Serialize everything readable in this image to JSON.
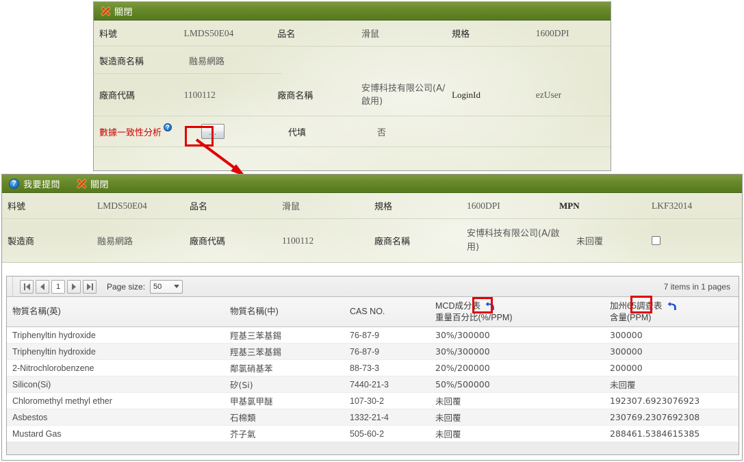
{
  "panel1": {
    "titlebar": {
      "close_label": "關閉",
      "close_icon": "close-x-icon"
    },
    "rows": [
      {
        "label1": "料號",
        "value1": "LMDS50E04",
        "label2": "品名",
        "value2": "滑鼠",
        "label3": "規格",
        "value3": "1600DPI"
      },
      {
        "label1": "製造商名稱",
        "value1": "融易網路"
      },
      {
        "label1": "廠商代碼",
        "value1": "1100112",
        "label2": "廠商名稱",
        "value2": "安博科技有限公司(A/啟用)",
        "label3": "LoginId",
        "value3": "ezUser"
      },
      {
        "label1": "數據一致性分析",
        "help_icon": "help-circle-icon",
        "button_label": "...",
        "label2": "代填",
        "value2": "否"
      }
    ]
  },
  "panel2": {
    "titlebar": {
      "ask_label": "我要提問",
      "ask_icon": "help-circle-icon",
      "close_label": "關閉",
      "close_icon": "close-x-icon"
    },
    "info": {
      "row1": {
        "label1": "料號",
        "value1": "LMDS50E04",
        "label2": "品名",
        "value2": "滑鼠",
        "label3": "規格",
        "value3": "1600DPI",
        "label4": "MPN",
        "value4": "LKF32014"
      },
      "row2": {
        "label1": "製造商",
        "value1": "融易網路",
        "label2": "廠商代碼",
        "value2": "1100112",
        "label3": "廠商名稱",
        "value3": "安博科技有限公司(A/啟用)",
        "value4": "未回覆",
        "checkbox": "unchecked"
      }
    },
    "pager": {
      "first_icon": "first-page-icon",
      "prev_icon": "prev-page-icon",
      "current_page": "1",
      "next_icon": "next-page-icon",
      "last_icon": "last-page-icon",
      "page_size_label": "Page size:",
      "page_size_value": "50",
      "page_size_caret": "chevron-down-icon",
      "item_count": "7 items in 1 pages"
    },
    "table": {
      "headers": [
        {
          "line1": "物質名稱(英)",
          "line2": ""
        },
        {
          "line1": "物質名稱(中)",
          "line2": ""
        },
        {
          "line1": "CAS NO.",
          "line2": ""
        },
        {
          "line1": "MCD成分表",
          "line2": "重量百分比(%/PPM)",
          "icon": "undo-arrow-icon"
        },
        {
          "line1": "加州65調查表",
          "line2": "含量(PPM)",
          "icon": "undo-arrow-icon"
        }
      ],
      "rows": [
        {
          "name_en": "Triphenyltin hydroxide",
          "name_zh": "羥基三苯基錫",
          "cas": "76-87-9",
          "mcd": "30%/300000",
          "ca65": "300000"
        },
        {
          "name_en": "Triphenyltin hydroxide",
          "name_zh": "羥基三苯基錫",
          "cas": "76-87-9",
          "mcd": "30%/300000",
          "ca65": "300000"
        },
        {
          "name_en": "2-Nitrochlorobenzene",
          "name_zh": "鄰氯硝基苯",
          "cas": "88-73-3",
          "mcd": "20%/200000",
          "ca65": "200000"
        },
        {
          "name_en": "Silicon(Si)",
          "name_zh": "矽(Si)",
          "cas": "7440-21-3",
          "mcd": "50%/500000",
          "ca65": "未回覆"
        },
        {
          "name_en": "Chloromethyl methyl ether",
          "name_zh": "甲基氯甲醚",
          "cas": "107-30-2",
          "mcd": "未回覆",
          "ca65": "192307.6923076923"
        },
        {
          "name_en": "Asbestos",
          "name_zh": "石棉類",
          "cas": "1332-21-4",
          "mcd": "未回覆",
          "ca65": "230769.2307692308"
        },
        {
          "name_en": "Mustard Gas",
          "name_zh": "芥子氣",
          "cas": "505-60-2",
          "mcd": "未回覆",
          "ca65": "288461.5384615385"
        }
      ]
    }
  },
  "annotations": {
    "highlight_color": "#e00000",
    "arrow": "red-arrow-pointer"
  }
}
